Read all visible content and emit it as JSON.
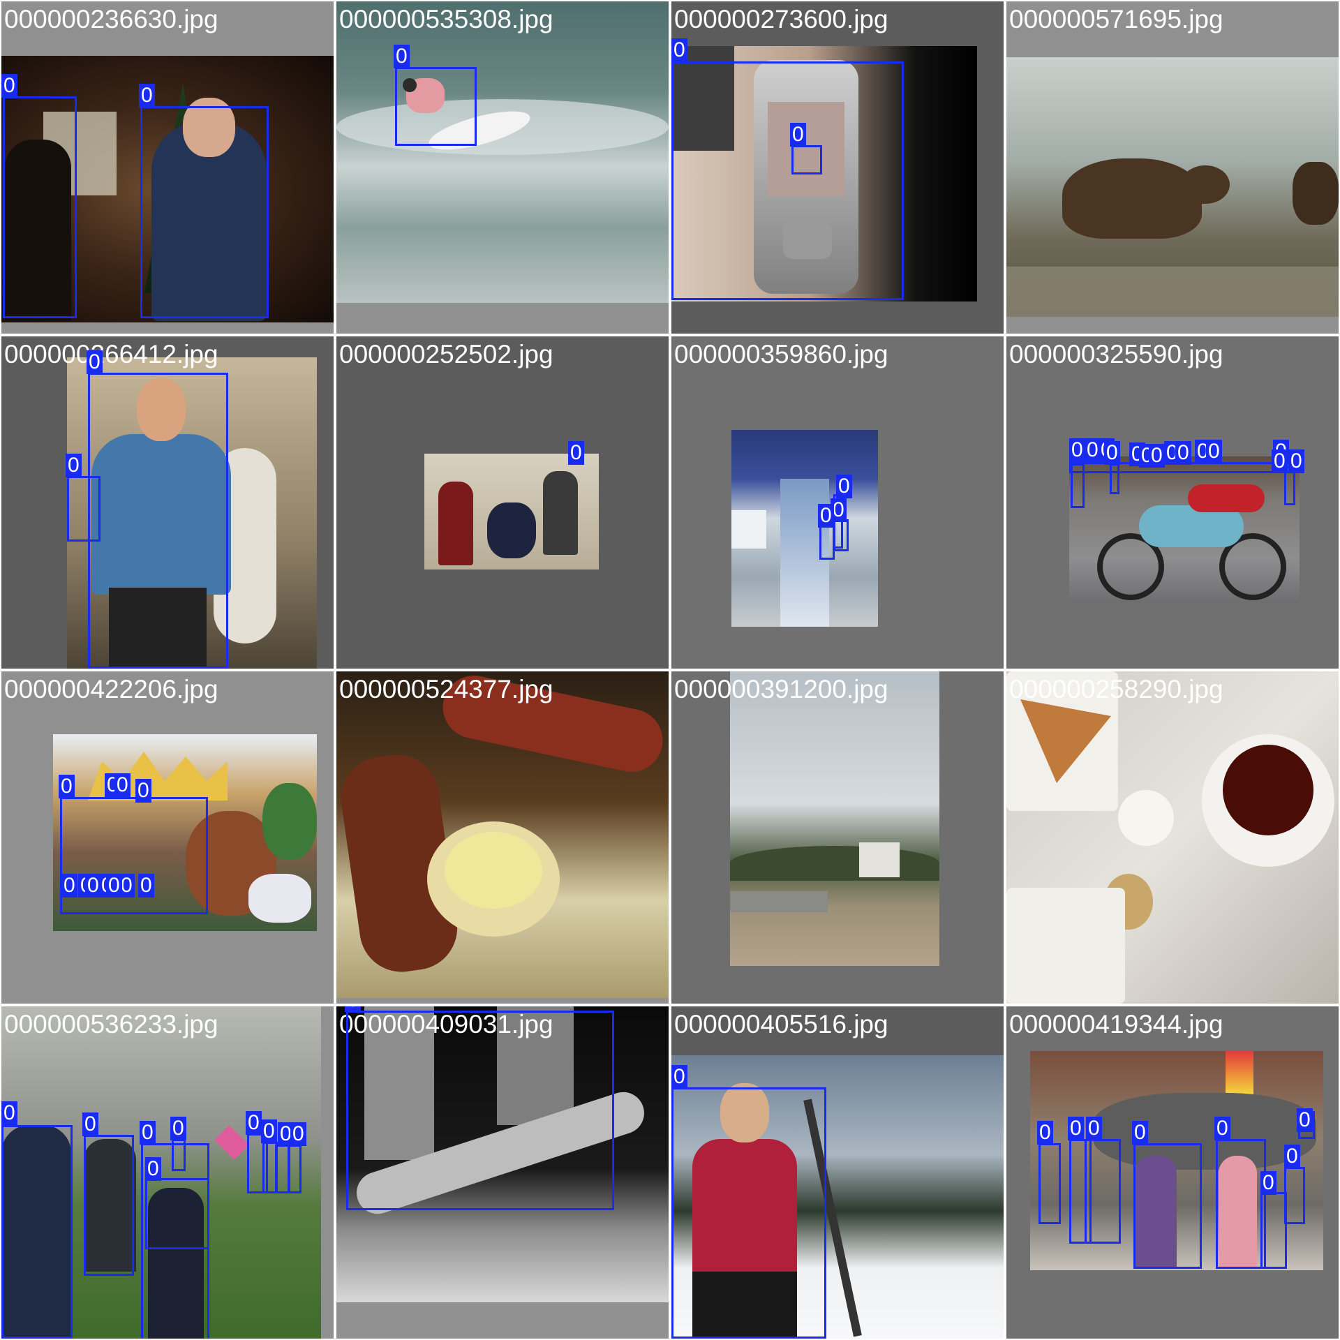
{
  "tiles": [
    {
      "filename": "000000236630.jpg",
      "labels": [
        "0",
        "0"
      ]
    },
    {
      "filename": "000000535308.jpg",
      "labels": [
        "0"
      ]
    },
    {
      "filename": "000000273600.jpg",
      "labels": [
        "0",
        "0"
      ]
    },
    {
      "filename": "000000571695.jpg",
      "labels": []
    },
    {
      "filename": "000000266412.jpg",
      "labels": [
        "0",
        "0"
      ]
    },
    {
      "filename": "000000252502.jpg",
      "labels": [
        "0"
      ]
    },
    {
      "filename": "000000359860.jpg",
      "labels": [
        "0",
        "0",
        "0"
      ]
    },
    {
      "filename": "000000325590.jpg",
      "labels": [
        "0",
        "0",
        "0",
        "0",
        "0",
        "0",
        "0",
        "0",
        "0",
        "0",
        "0",
        "0",
        "0",
        "0"
      ]
    },
    {
      "filename": "000000422206.jpg",
      "labels": [
        "0",
        "0",
        "0",
        "0",
        "0",
        "0",
        "0",
        "0",
        "0",
        "0",
        "0"
      ]
    },
    {
      "filename": "000000524377.jpg",
      "labels": []
    },
    {
      "filename": "000000391200.jpg",
      "labels": []
    },
    {
      "filename": "000000258290.jpg",
      "labels": []
    },
    {
      "filename": "000000536233.jpg",
      "labels": [
        "0",
        "0",
        "0",
        "0",
        "0",
        "0",
        "0",
        "0",
        "0"
      ]
    },
    {
      "filename": "000000409031.jpg",
      "labels": [
        "0"
      ]
    },
    {
      "filename": "000000405516.jpg",
      "labels": [
        "0"
      ]
    },
    {
      "filename": "000000419344.jpg",
      "labels": [
        "0",
        "0",
        "0",
        "0",
        "0",
        "0",
        "0",
        "0"
      ]
    }
  ],
  "colors": {
    "box": "#1a2bf0",
    "label_text": "#ffffff",
    "tile_background": "#909090",
    "filename_text": "#ffffff"
  }
}
